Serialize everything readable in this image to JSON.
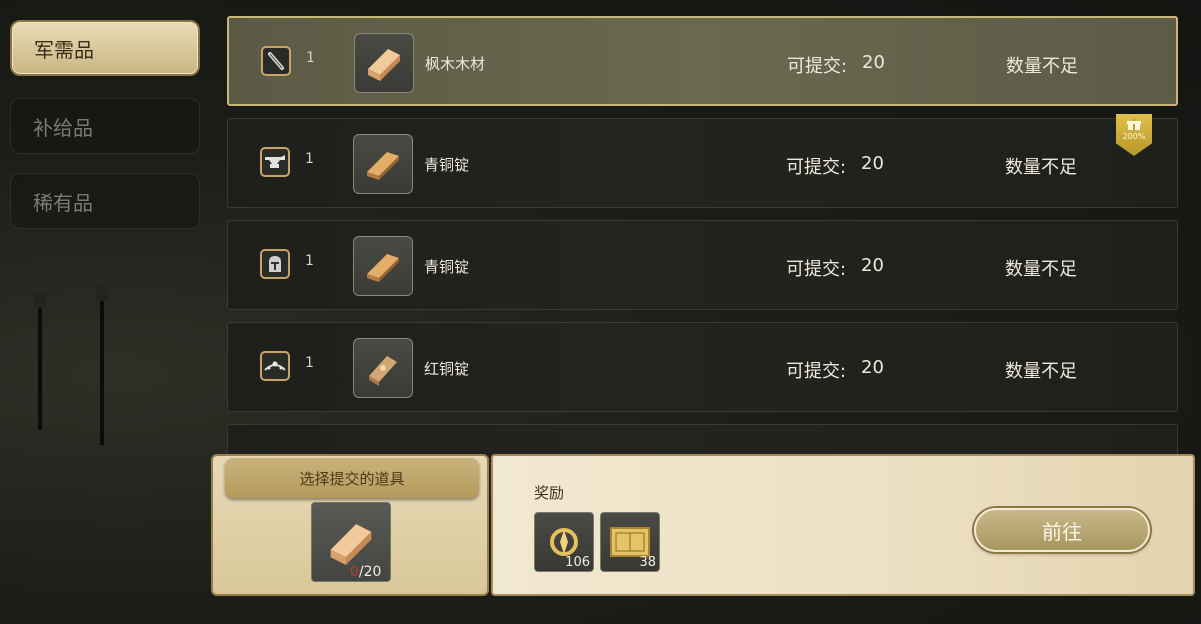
{
  "tabs": [
    {
      "label": "军需品",
      "active": true
    },
    {
      "label": "补给品",
      "active": false
    },
    {
      "label": "稀有品",
      "active": false
    }
  ],
  "rows": [
    {
      "cond_icon": "dagger-icon",
      "cond_count": "1",
      "item_icon": "maple-wood-icon",
      "item_name": "枫木木材",
      "submit_label": "可提交:",
      "submit_value": "20",
      "status": "数量不足",
      "selected": true
    },
    {
      "cond_icon": "anvil-icon",
      "cond_count": "1",
      "item_icon": "bronze-ingot-icon",
      "item_name": "青铜锭",
      "submit_label": "可提交:",
      "submit_value": "20",
      "status": "数量不足",
      "selected": false
    },
    {
      "cond_icon": "knight-helmet-icon",
      "cond_count": "1",
      "item_icon": "bronze-ingot-icon",
      "item_name": "青铜锭",
      "submit_label": "可提交:",
      "submit_value": "20",
      "status": "数量不足",
      "selected": false
    },
    {
      "cond_icon": "tiara-icon",
      "cond_count": "1",
      "item_icon": "copper-ingot-icon",
      "item_name": "红铜锭",
      "submit_label": "可提交:",
      "submit_value": "20",
      "status": "数量不足",
      "selected": false
    }
  ],
  "bonus_badge": {
    "icon": "gift-icon",
    "text": "200%"
  },
  "submit_panel": {
    "title": "选择提交的道具",
    "item_icon": "maple-wood-icon",
    "current": "0",
    "separator": "/",
    "required": "20"
  },
  "reward_panel": {
    "title": "奖励",
    "rewards": [
      {
        "icon": "gold-emblem-icon",
        "count": "106"
      },
      {
        "icon": "gold-ticket-icon",
        "count": "38"
      }
    ],
    "go_button": "前往"
  },
  "colors": {
    "accent_gold": "#cbb67a",
    "selected_row": "#6b6850",
    "insufficient_count": "#b83a2e"
  }
}
